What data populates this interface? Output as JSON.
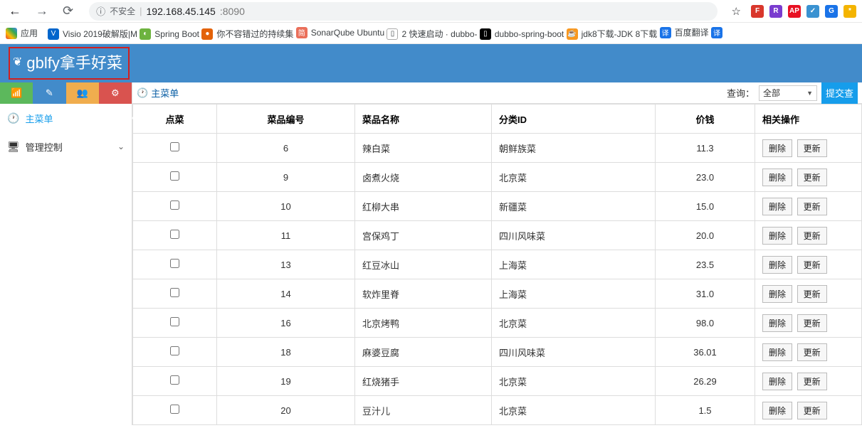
{
  "browser": {
    "insecure_label": "不安全",
    "host": "192.168.45.145",
    "port": ":8090",
    "ext_badges": [
      {
        "bg": "#d9372c",
        "txt": "F"
      },
      {
        "bg": "#7a3ccf",
        "txt": "R"
      },
      {
        "bg": "#e81123",
        "txt": "AP"
      },
      {
        "bg": "#3a92d1",
        "txt": "✓"
      },
      {
        "bg": "#1a73e8",
        "txt": "G"
      },
      {
        "bg": "#f4b400",
        "txt": "*"
      }
    ]
  },
  "bookmarks": {
    "apps": "应用",
    "items": [
      {
        "icon": "V",
        "bg": "#0066cc",
        "label": "Visio 2019破解版|M"
      },
      {
        "icon": "◐",
        "bg": "#6db33f",
        "label": "Spring Boot"
      },
      {
        "icon": "●",
        "bg": "#e36209",
        "label": "你不容错过的持续集"
      },
      {
        "icon": "简",
        "bg": "#ea6f5a",
        "label": "SonarQube Ubuntu"
      },
      {
        "icon": "",
        "bg": "",
        "label": "2 快速启动 · dubbo-"
      },
      {
        "icon": "",
        "bg": "#000",
        "label": "dubbo-spring-boot"
      },
      {
        "icon": "☕",
        "bg": "#f89820",
        "label": "jdk8下载-JDK 8下载"
      },
      {
        "icon": "译",
        "bg": "#1a73e8",
        "label": "百度翻译"
      },
      {
        "icon": "译",
        "bg": "#1a73e8",
        "label": ""
      }
    ]
  },
  "brand": "gblfy拿手好菜",
  "sidebar": {
    "main_menu": "主菜单",
    "mgmt": "管理控制"
  },
  "crumb": {
    "dash_icon": "⚙",
    "label": "主菜单",
    "query": "查询：",
    "select": "全部",
    "submit": "提交查"
  },
  "table": {
    "headers": {
      "check": "点菜",
      "id": "菜品编号",
      "name": "菜品名称",
      "cat": "分类ID",
      "price": "价钱",
      "ops": "相关操作"
    },
    "ops": {
      "del": "删除",
      "upd": "更新"
    },
    "rows": [
      {
        "id": "6",
        "name": "辣白菜",
        "cat": "朝鲜族菜",
        "price": "11.3"
      },
      {
        "id": "9",
        "name": "卤煮火烧",
        "cat": "北京菜",
        "price": "23.0"
      },
      {
        "id": "10",
        "name": "红柳大串",
        "cat": "新疆菜",
        "price": "15.0"
      },
      {
        "id": "11",
        "name": "宫保鸡丁",
        "cat": "四川风味菜",
        "price": "20.0"
      },
      {
        "id": "13",
        "name": "红豆冰山",
        "cat": "上海菜",
        "price": "23.5"
      },
      {
        "id": "14",
        "name": "软炸里脊",
        "cat": "上海菜",
        "price": "31.0"
      },
      {
        "id": "16",
        "name": "北京烤鸭",
        "cat": "北京菜",
        "price": "98.0"
      },
      {
        "id": "18",
        "name": "麻婆豆腐",
        "cat": "四川风味菜",
        "price": "36.01"
      },
      {
        "id": "19",
        "name": "红烧猪手",
        "cat": "北京菜",
        "price": "26.29"
      },
      {
        "id": "20",
        "name": "豆汁儿",
        "cat": "北京菜",
        "price": "1.5"
      }
    ]
  }
}
